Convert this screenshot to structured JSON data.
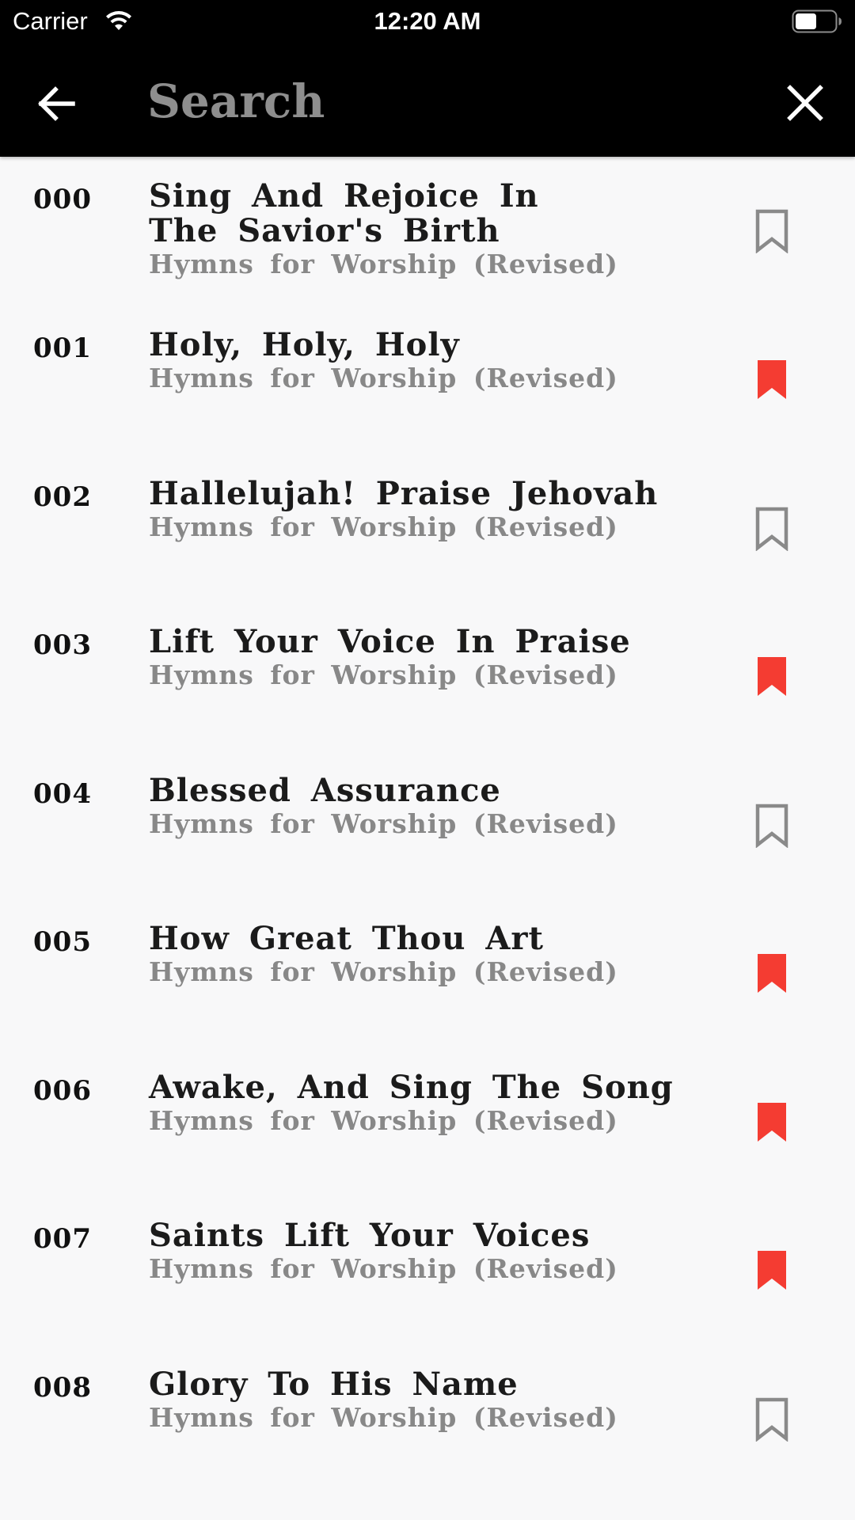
{
  "status_bar": {
    "carrier": "Carrier",
    "time": "12:20 AM",
    "wifi_icon": "wifi-icon",
    "battery_icon": "battery-icon"
  },
  "nav_bar": {
    "back_icon": "arrow-left-icon",
    "search_placeholder": "Search",
    "search_value": "",
    "close_icon": "close-icon",
    "background_color": "#000000"
  },
  "colors": {
    "bookmarked": "#f43c32",
    "bookmark_outline": "#8a8a8a",
    "subtitle": "#888888",
    "title": "#1b1b1b"
  },
  "hymns": [
    {
      "number": "000",
      "title": "Sing And Rejoice In The Savior's Birth",
      "book": "Hymns for Worship (Revised)",
      "bookmarked": false
    },
    {
      "number": "001",
      "title": "Holy, Holy, Holy",
      "book": "Hymns for Worship (Revised)",
      "bookmarked": true
    },
    {
      "number": "002",
      "title": "Hallelujah! Praise Jehovah",
      "book": "Hymns for Worship (Revised)",
      "bookmarked": false
    },
    {
      "number": "003",
      "title": "Lift Your Voice In Praise",
      "book": "Hymns for Worship (Revised)",
      "bookmarked": true
    },
    {
      "number": "004",
      "title": "Blessed Assurance",
      "book": "Hymns for Worship (Revised)",
      "bookmarked": false
    },
    {
      "number": "005",
      "title": "How Great Thou Art",
      "book": "Hymns for Worship (Revised)",
      "bookmarked": true
    },
    {
      "number": "006",
      "title": "Awake, And Sing The Song",
      "book": "Hymns for Worship (Revised)",
      "bookmarked": true
    },
    {
      "number": "007",
      "title": "Saints Lift Your Voices",
      "book": "Hymns for Worship (Revised)",
      "bookmarked": true
    },
    {
      "number": "008",
      "title": "Glory To His Name",
      "book": "Hymns for Worship (Revised)",
      "bookmarked": false
    }
  ]
}
